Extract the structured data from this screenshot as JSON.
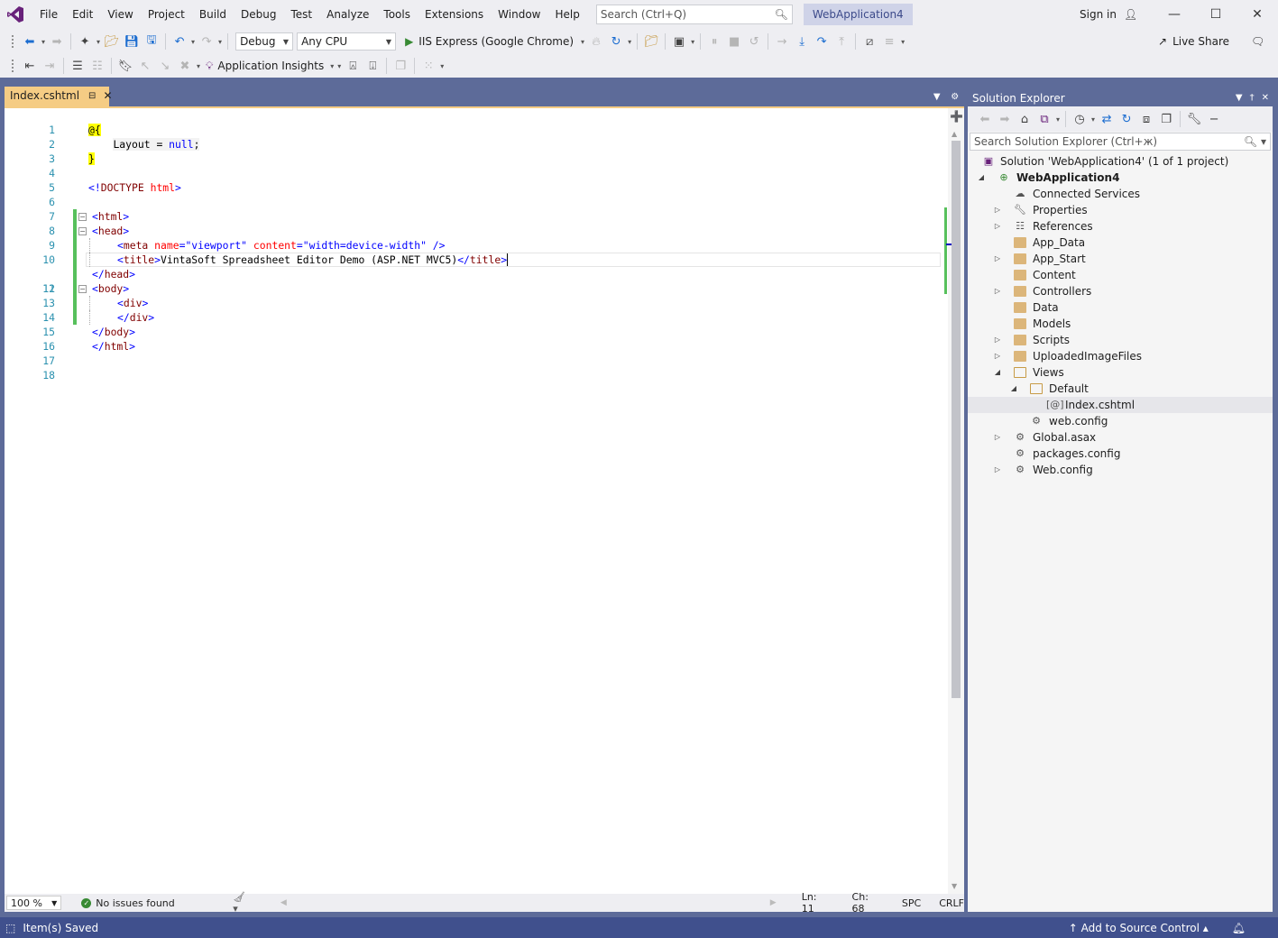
{
  "window": {
    "menu": [
      "File",
      "Edit",
      "View",
      "Project",
      "Build",
      "Debug",
      "Test",
      "Analyze",
      "Tools",
      "Extensions",
      "Window",
      "Help"
    ],
    "search_placeholder": "Search (Ctrl+Q)",
    "solution_title": "WebApplication4",
    "sign_in": "Sign in",
    "live_share": "Live Share"
  },
  "toolbar": {
    "configuration": "Debug",
    "platform": "Any CPU",
    "run_target": "IIS Express (Google Chrome)",
    "application_insights": "Application Insights"
  },
  "editor": {
    "tab_title": "Index.cshtml",
    "zoom": "100 %",
    "issues": "No issues found",
    "line": "Ln: 11",
    "column": "Ch: 68",
    "whitespace": "SPC",
    "line_ending": "CRLF",
    "lines": [
      {
        "num": "1"
      },
      {
        "num": "2",
        "razor_open": "@{"
      },
      {
        "num": "3",
        "layout": "Layout = ",
        "null_kw": "null",
        "semi": ";"
      },
      {
        "num": "4",
        "razor_close": "}"
      },
      {
        "num": "5"
      },
      {
        "num": "6",
        "d1": "<!",
        "tag": "DOCTYPE ",
        "attr": "html",
        "d2": ">"
      },
      {
        "num": "7"
      },
      {
        "num": "8",
        "d1": "<",
        "tag": "html",
        "d2": ">"
      },
      {
        "num": "9",
        "d1": "<",
        "tag": "head",
        "d2": ">"
      },
      {
        "num": "10",
        "d1": "<",
        "tag": "meta ",
        "a1": "name",
        "eq1": "=",
        "v1": "\"viewport\"",
        "a2": " content",
        "eq2": "=",
        "v2": "\"width=device-width\"",
        "d2": " />"
      },
      {
        "num": "11",
        "d1": "<",
        "tag": "title",
        "d2": ">",
        "text": "VintaSoft Spreadsheet Editor Demo (ASP.NET MVC5)",
        "d3": "</",
        "tag2": "title",
        "d4": ">"
      },
      {
        "num": "12",
        "d1": "</",
        "tag": "head",
        "d2": ">"
      },
      {
        "num": "13",
        "d1": "<",
        "tag": "body",
        "d2": ">"
      },
      {
        "num": "14",
        "d1": "<",
        "tag": "div",
        "d2": ">"
      },
      {
        "num": "15",
        "d1": "</",
        "tag": "div",
        "d2": ">"
      },
      {
        "num": "16",
        "d1": "</",
        "tag": "body",
        "d2": ">"
      },
      {
        "num": "17",
        "d1": "</",
        "tag": "html",
        "d2": ">"
      },
      {
        "num": "18"
      }
    ]
  },
  "solution_explorer": {
    "title": "Solution Explorer",
    "search_placeholder": "Search Solution Explorer (Ctrl+ж)",
    "items": [
      {
        "label": "Solution 'WebApplication4' (1 of 1 project)"
      },
      {
        "label": "WebApplication4"
      },
      {
        "label": "Connected Services"
      },
      {
        "label": "Properties"
      },
      {
        "label": "References"
      },
      {
        "label": "App_Data"
      },
      {
        "label": "App_Start"
      },
      {
        "label": "Content"
      },
      {
        "label": "Controllers"
      },
      {
        "label": "Data"
      },
      {
        "label": "Models"
      },
      {
        "label": "Scripts"
      },
      {
        "label": "UploadedImageFiles"
      },
      {
        "label": "Views"
      },
      {
        "label": "Default"
      },
      {
        "label": "Index.cshtml"
      },
      {
        "label": "web.config"
      },
      {
        "label": "Global.asax"
      },
      {
        "label": "packages.config"
      },
      {
        "label": "Web.config"
      }
    ]
  },
  "statusbar": {
    "message": "Item(s) Saved",
    "source_control": "Add to Source Control"
  },
  "colors": {
    "accent": "#5d6b99",
    "tab_active": "#f5cc84",
    "statusbar": "#40508d",
    "change_marker": "#57c05c"
  }
}
